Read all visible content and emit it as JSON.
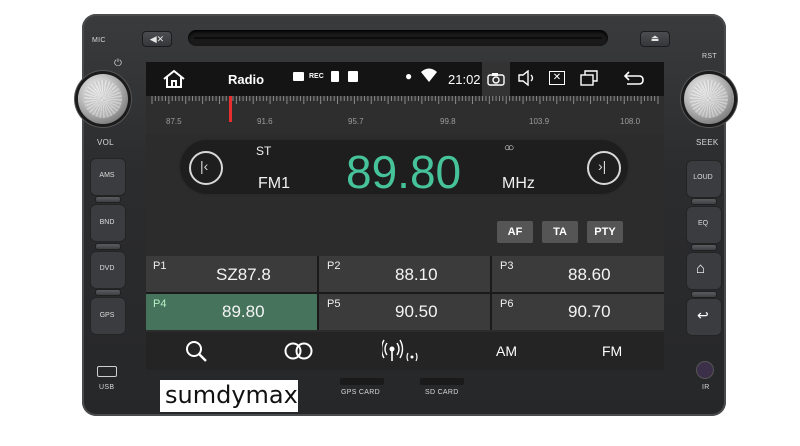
{
  "device": {
    "labels": {
      "mic": "MIC",
      "rst": "RST",
      "vol": "VOL",
      "seek": "SEEK",
      "usb": "USB",
      "ir": "IR",
      "gps_card": "GPS CARD",
      "sd_card": "SD CARD"
    },
    "left_buttons": [
      "AMS",
      "BND",
      "DVD",
      "GPS"
    ],
    "right_buttons": [
      "LOUD",
      "EQ"
    ],
    "watermark": "sumdymax"
  },
  "status_bar": {
    "title": "Radio",
    "time": "21:02"
  },
  "dial": {
    "ticks": [
      "87.5",
      "91.6",
      "95.7",
      "99.8",
      "103.9",
      "108.0"
    ],
    "range": [
      87.5,
      108.0
    ],
    "needle_value": 89.8,
    "needle_color": "#e63030"
  },
  "tuner": {
    "st_label": "ST",
    "band": "FM1",
    "frequency": "89.80",
    "unit": "MHz",
    "freq_color": "#46c39a"
  },
  "soft_buttons": [
    "AF",
    "TA",
    "PTY"
  ],
  "presets": [
    {
      "index": "P1",
      "value": "SZ87.8",
      "active": false
    },
    {
      "index": "P2",
      "value": "88.10",
      "active": false
    },
    {
      "index": "P3",
      "value": "88.60",
      "active": false
    },
    {
      "index": "P4",
      "value": "89.80",
      "active": true
    },
    {
      "index": "P5",
      "value": "90.50",
      "active": false
    },
    {
      "index": "P6",
      "value": "90.70",
      "active": false
    }
  ],
  "bottom_bar": {
    "am": "AM",
    "fm": "FM"
  }
}
